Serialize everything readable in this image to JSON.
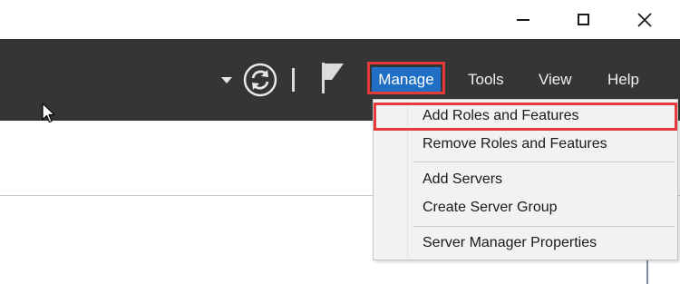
{
  "titlebar": {
    "minimize_icon": "minimize-icon",
    "maximize_icon": "maximize-icon",
    "close_icon": "close-icon"
  },
  "toolbar": {
    "background": "#353535",
    "refresh_icon": "refresh-icon",
    "flag_icon": "flag-icon",
    "menu": {
      "manage": "Manage",
      "tools": "Tools",
      "view": "View",
      "help": "Help"
    },
    "active_menu_color": "#1f6fc4",
    "highlight_color": "#e53a3a"
  },
  "manage_menu": {
    "items": [
      "Add Roles and Features",
      "Remove Roles and Features",
      "Add Servers",
      "Create Server Group",
      "Server Manager Properties"
    ]
  }
}
